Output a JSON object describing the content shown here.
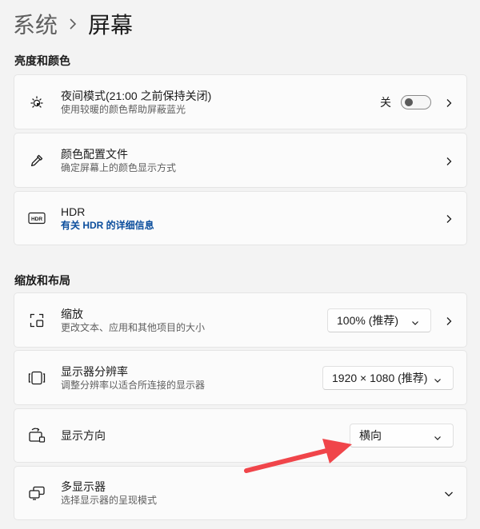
{
  "breadcrumb": {
    "parent": "系统",
    "current": "屏幕"
  },
  "sections": {
    "brightness_title": "亮度和颜色",
    "scale_title": "缩放和布局"
  },
  "night_light": {
    "title": "夜间模式(21:00 之前保持关闭)",
    "subtitle": "使用较暖的颜色帮助屏蔽蓝光",
    "toggle_label": "关",
    "toggle_on": false
  },
  "color_profile": {
    "title": "颜色配置文件",
    "subtitle": "确定屏幕上的颜色显示方式"
  },
  "hdr": {
    "icon_text": "HDR",
    "title": "HDR",
    "link": "有关 HDR 的详细信息"
  },
  "scale": {
    "title": "缩放",
    "subtitle": "更改文本、应用和其他项目的大小",
    "value": "100% (推荐)"
  },
  "resolution": {
    "title": "显示器分辨率",
    "subtitle": "调整分辨率以适合所连接的显示器",
    "value": "1920 × 1080 (推荐)"
  },
  "orientation": {
    "title": "显示方向",
    "value": "横向"
  },
  "multi_display": {
    "title": "多显示器",
    "subtitle": "选择显示器的呈现模式"
  },
  "colors": {
    "annotation_arrow": "#f0454a",
    "link": "#0a4d9c"
  }
}
